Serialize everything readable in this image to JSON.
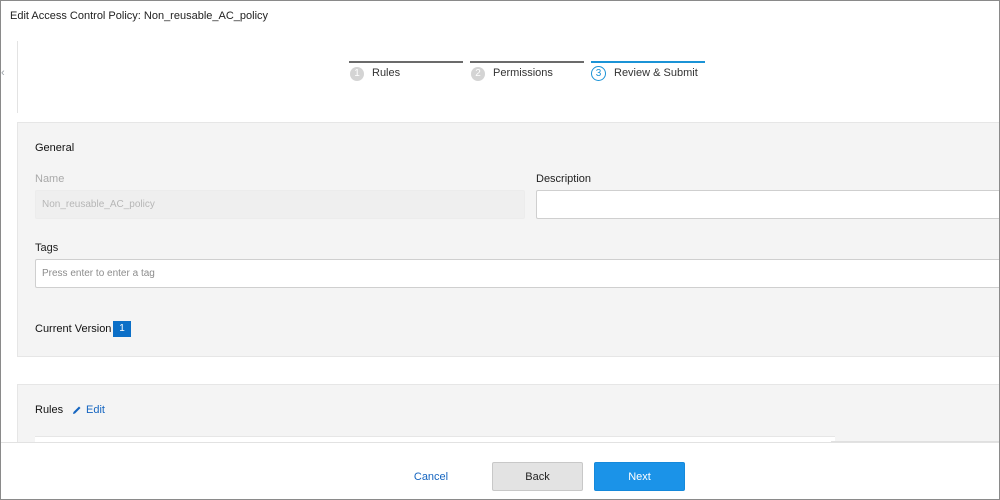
{
  "modal": {
    "title": "Edit Access Control Policy: Non_reusable_AC_policy"
  },
  "wizard": {
    "steps": [
      {
        "number": "1",
        "label": "Rules"
      },
      {
        "number": "2",
        "label": "Permissions"
      },
      {
        "number": "3",
        "label": "Review & Submit"
      }
    ],
    "active_step": 3
  },
  "general": {
    "title": "General",
    "name_label": "Name",
    "name_value": "Non_reusable_AC_policy",
    "description_label": "Description",
    "description_value": "",
    "tags_label": "Tags",
    "tags_placeholder": "Press enter to enter a tag",
    "current_version_label": "Current Version",
    "current_version_value": "1"
  },
  "rules": {
    "title": "Rules",
    "edit_label": "Edit"
  },
  "footer": {
    "cancel_label": "Cancel",
    "back_label": "Back",
    "next_label": "Next"
  },
  "colors": {
    "accent": "#1b93e8",
    "link": "#1565c0",
    "badge": "#0b6fc7"
  }
}
